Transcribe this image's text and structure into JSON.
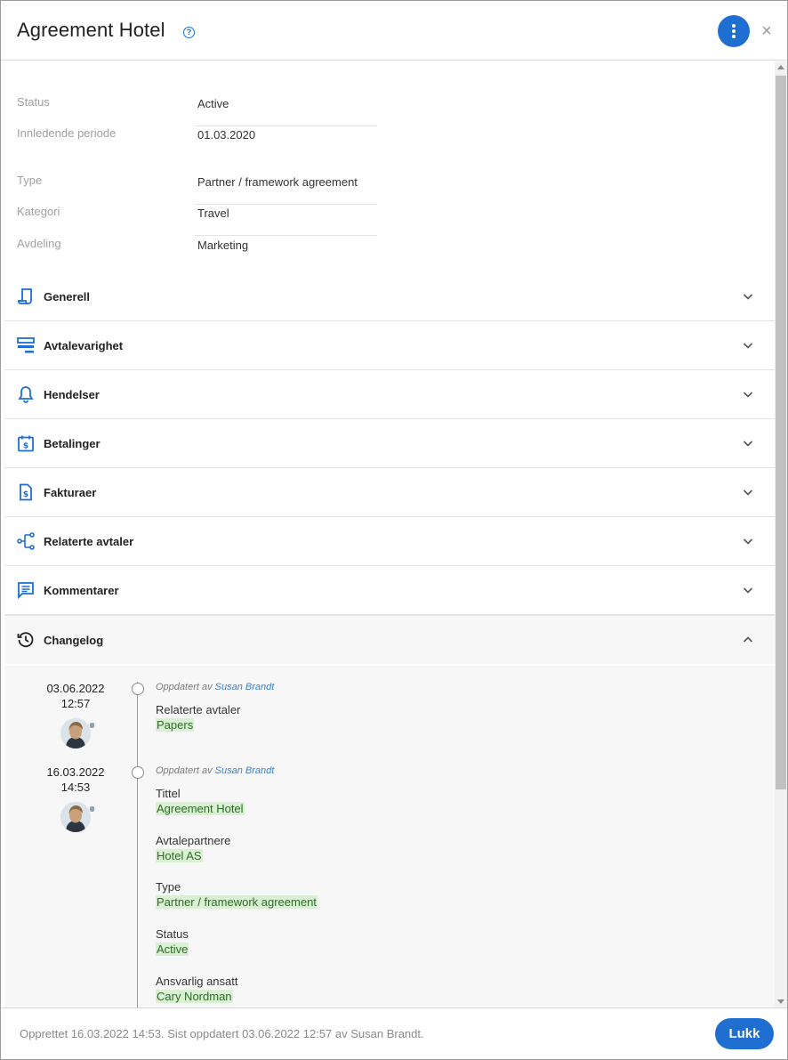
{
  "header": {
    "title": "Agreement Hotel",
    "help_icon": "?",
    "more_icon": "more-vertical",
    "close_icon": "×"
  },
  "fields": [
    {
      "label": "Status",
      "value": "Active"
    },
    {
      "label": "Innledende periode",
      "value": "01.03.2020"
    },
    {
      "label": "Type",
      "value": "Partner / framework agreement"
    },
    {
      "label": "Kategori",
      "value": "Travel"
    },
    {
      "label": "Avdeling",
      "value": "Marketing"
    }
  ],
  "sections": [
    {
      "label": "Generell",
      "icon": "scroll-icon"
    },
    {
      "label": "Avtalevarighet",
      "icon": "duration-icon"
    },
    {
      "label": "Hendelser",
      "icon": "bell-icon"
    },
    {
      "label": "Betalinger",
      "icon": "calendar-dollar-icon"
    },
    {
      "label": "Fakturaer",
      "icon": "invoice-icon"
    },
    {
      "label": "Relaterte avtaler",
      "icon": "related-icon"
    },
    {
      "label": "Kommentarer",
      "icon": "comment-icon"
    },
    {
      "label": "Changelog",
      "icon": "history-icon"
    }
  ],
  "changelog": {
    "entries": [
      {
        "date": "03.06.2022",
        "time": "12:57",
        "meta_prefix": "Oppdatert av",
        "user": "Susan Brandt",
        "changes": [
          {
            "label": "Relaterte avtaler",
            "value": "Papers"
          }
        ]
      },
      {
        "date": "16.03.2022",
        "time": "14:53",
        "meta_prefix": "Oppdatert av",
        "user": "Susan Brandt",
        "changes": [
          {
            "label": "Tittel",
            "value": "Agreement Hotel"
          },
          {
            "label": "Avtalepartnere",
            "value": "Hotel AS"
          },
          {
            "label": "Type",
            "value": "Partner / framework agreement"
          },
          {
            "label": "Status",
            "value": "Active"
          },
          {
            "label": "Ansvarlig ansatt",
            "value": "Cary Nordman"
          }
        ]
      }
    ]
  },
  "footer": {
    "text": "Opprettet 16.03.2022 14:53. Sist oppdatert 03.06.2022 12:57 av Susan Brandt.",
    "close_label": "Lukk"
  },
  "colors": {
    "accent": "#1e6fd1",
    "highlight_bg": "#d9f0d3",
    "link": "#3b82d6"
  }
}
